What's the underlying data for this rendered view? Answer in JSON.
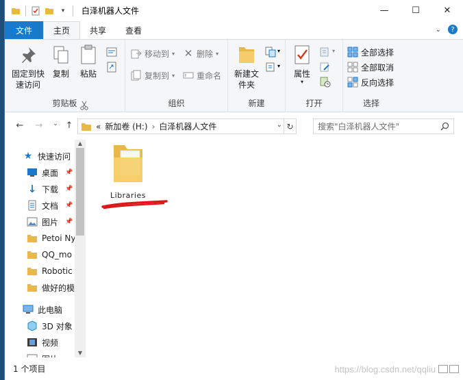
{
  "window": {
    "title": "白泽机器人文件",
    "controls": [
      "—",
      "☐",
      "✕"
    ]
  },
  "ribbon_tabs": [
    {
      "label": "文件"
    },
    {
      "label": "主页"
    },
    {
      "label": "共享"
    },
    {
      "label": "查看"
    }
  ],
  "ribbon": {
    "clipboard": {
      "pin_label": "固定到快速访问",
      "copy_label": "复制",
      "paste_label": "粘贴",
      "group_label": "剪贴板"
    },
    "organize": {
      "move_label": "移动到",
      "copy_to_label": "复制到",
      "delete_label": "删除",
      "rename_label": "重命名",
      "group_label": "组织"
    },
    "new": {
      "new_folder_label": "新建文件夹",
      "group_label": "新建"
    },
    "open": {
      "properties_label": "属性",
      "group_label": "打开"
    },
    "select": {
      "select_all_label": "全部选择",
      "select_none_label": "全部取消",
      "invert_label": "反向选择",
      "group_label": "选择"
    }
  },
  "address": {
    "overflow": "«",
    "drive": "新加卷 (H:)",
    "sep": "›",
    "folder": "白泽机器人文件"
  },
  "search": {
    "placeholder": "搜索\"白泽机器人文件\""
  },
  "nav": {
    "quick_access": "快速访问",
    "items": [
      {
        "label": "桌面"
      },
      {
        "label": "下载"
      },
      {
        "label": "文档"
      },
      {
        "label": "图片"
      },
      {
        "label": "Petoi Ny"
      },
      {
        "label": "QQ_mo"
      },
      {
        "label": "Robotic"
      },
      {
        "label": "做好的模"
      }
    ],
    "this_pc": "此电脑",
    "pc_items": [
      {
        "label": "3D 对象"
      },
      {
        "label": "视频"
      },
      {
        "label": "图片"
      }
    ]
  },
  "files": [
    {
      "name": "Libraries"
    }
  ],
  "status": {
    "count": "1 个项目"
  },
  "watermark": "https://blog.csdn.net/qqliu",
  "colors": {
    "accent": "#1979ca",
    "folder": "#e8b84a",
    "annotation": "#e0161b"
  }
}
